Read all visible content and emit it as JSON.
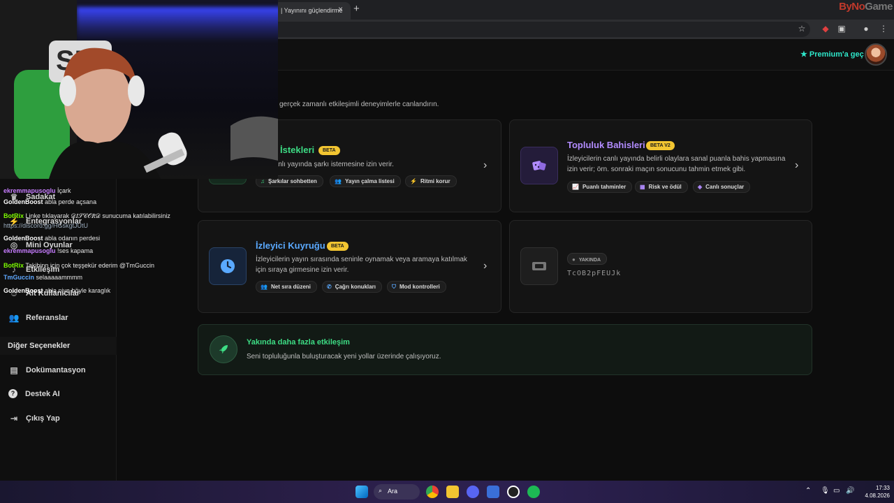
{
  "browser": {
    "tab_title": "| Yayınını güçlendirme",
    "tab_close": "×",
    "new_tab": "+",
    "watermark_a": "ByNo",
    "watermark_b": "Game"
  },
  "header": {
    "premium_label": "Premium'a geç"
  },
  "sidebar": {
    "items": [
      {
        "label": "Sadakat"
      },
      {
        "label": "Entegrasyonlar"
      },
      {
        "label": "Mini Oyunlar"
      },
      {
        "label": "Etkileşim"
      },
      {
        "label": "Alt Kullanıcılar"
      },
      {
        "label": "Referanslar"
      }
    ],
    "other_heading": "Diğer Seçenekler",
    "other_items": [
      {
        "label": "Dokümantasyon"
      },
      {
        "label": "Destek AI"
      },
      {
        "label": "Çıkış Yap"
      }
    ]
  },
  "main": {
    "subtitle": "gerçek zamanlı etkileşimli deneyimlerle canlandırın.",
    "song_card": {
      "title": "İstekleri",
      "badge": "BETA",
      "desc": "lerin canlı yayında şarkı istemesine izin verir.",
      "chips": [
        "Şarkılar sohbetten",
        "Yayın çalma listesi",
        "Ritmi korur"
      ]
    },
    "bet_card": {
      "title": "Topluluk Bahisleri",
      "badge": "BETA V2",
      "desc_1": "İzleyicilerin canlı yayında belirli olaylara sanal puanla bahis yapmasına",
      "desc_2": "izin verir; örn. sonraki maçın sonucunu tahmin etmek gibi.",
      "chips": [
        "Puanlı tahminler",
        "Risk ve ödül",
        "Canlı sonuçlar"
      ]
    },
    "queue_card": {
      "title": "İzleyici Kuyruğu",
      "badge": "BETA",
      "desc_1": "İzleyicilerin yayın sırasında seninle oynamak veya aramaya katılmak",
      "desc_2": "için sıraya girmesine izin verir.",
      "chips": [
        "Net sıra düzeni",
        "Çağrı konukları",
        "Mod kontrolleri"
      ]
    },
    "soon_card": {
      "badge": "YAKINDA",
      "code": "TcOB2pFEUJk"
    },
    "more_card": {
      "title": "Yakında daha fazla etkileşim",
      "desc": "Seni topluluğunla buluşturacak yeni yollar üzerinde çalışıyoruz."
    }
  },
  "chat": {
    "lines": [
      {
        "user": "ekremmapusoglu",
        "msg": "İçark",
        "color": "#c77dff"
      },
      {
        "user": "GoldenBoost",
        "msg": "abla perde açsana",
        "color": "#ffffff"
      },
      {
        "user": "BotRix",
        "msg": "Linke tıklayarak 𝒟𝐼𝒮𝒞𝒪𝑅𝒟 sunucuma katılabilirsiniz",
        "color": "#7cfc00"
      },
      {
        "user": "",
        "msg": "https://discord.gg/HGskgtJUtU",
        "color": "#9ab"
      },
      {
        "user": "GoldenBoost",
        "msg": "abla odanın perdesi",
        "color": "#ffffff"
      },
      {
        "user": "ekremmapusoglu",
        "msg": "!ses kapama",
        "color": "#c77dff"
      },
      {
        "user": "BotRix",
        "msg": "Takibinn için çok teşşekür ederim @TmGuccin",
        "color": "#7cfc00"
      },
      {
        "user": "TmGuccin",
        "msg": "selaaaaammmm",
        "color": "#5fa8ff"
      },
      {
        "user": "GoldenBoost",
        "msg": "abla niye böyle karaglık",
        "color": "#ffffff"
      }
    ]
  },
  "taskbar": {
    "search_label": "Ara",
    "time": "17:33",
    "date": "4.08.2026"
  },
  "colors": {
    "accent_green": "#3ddc84",
    "accent_purple": "#b28cff",
    "accent_blue": "#5aa9ff",
    "badge_yellow": "#f2c531",
    "premium": "#2ee6c9"
  }
}
